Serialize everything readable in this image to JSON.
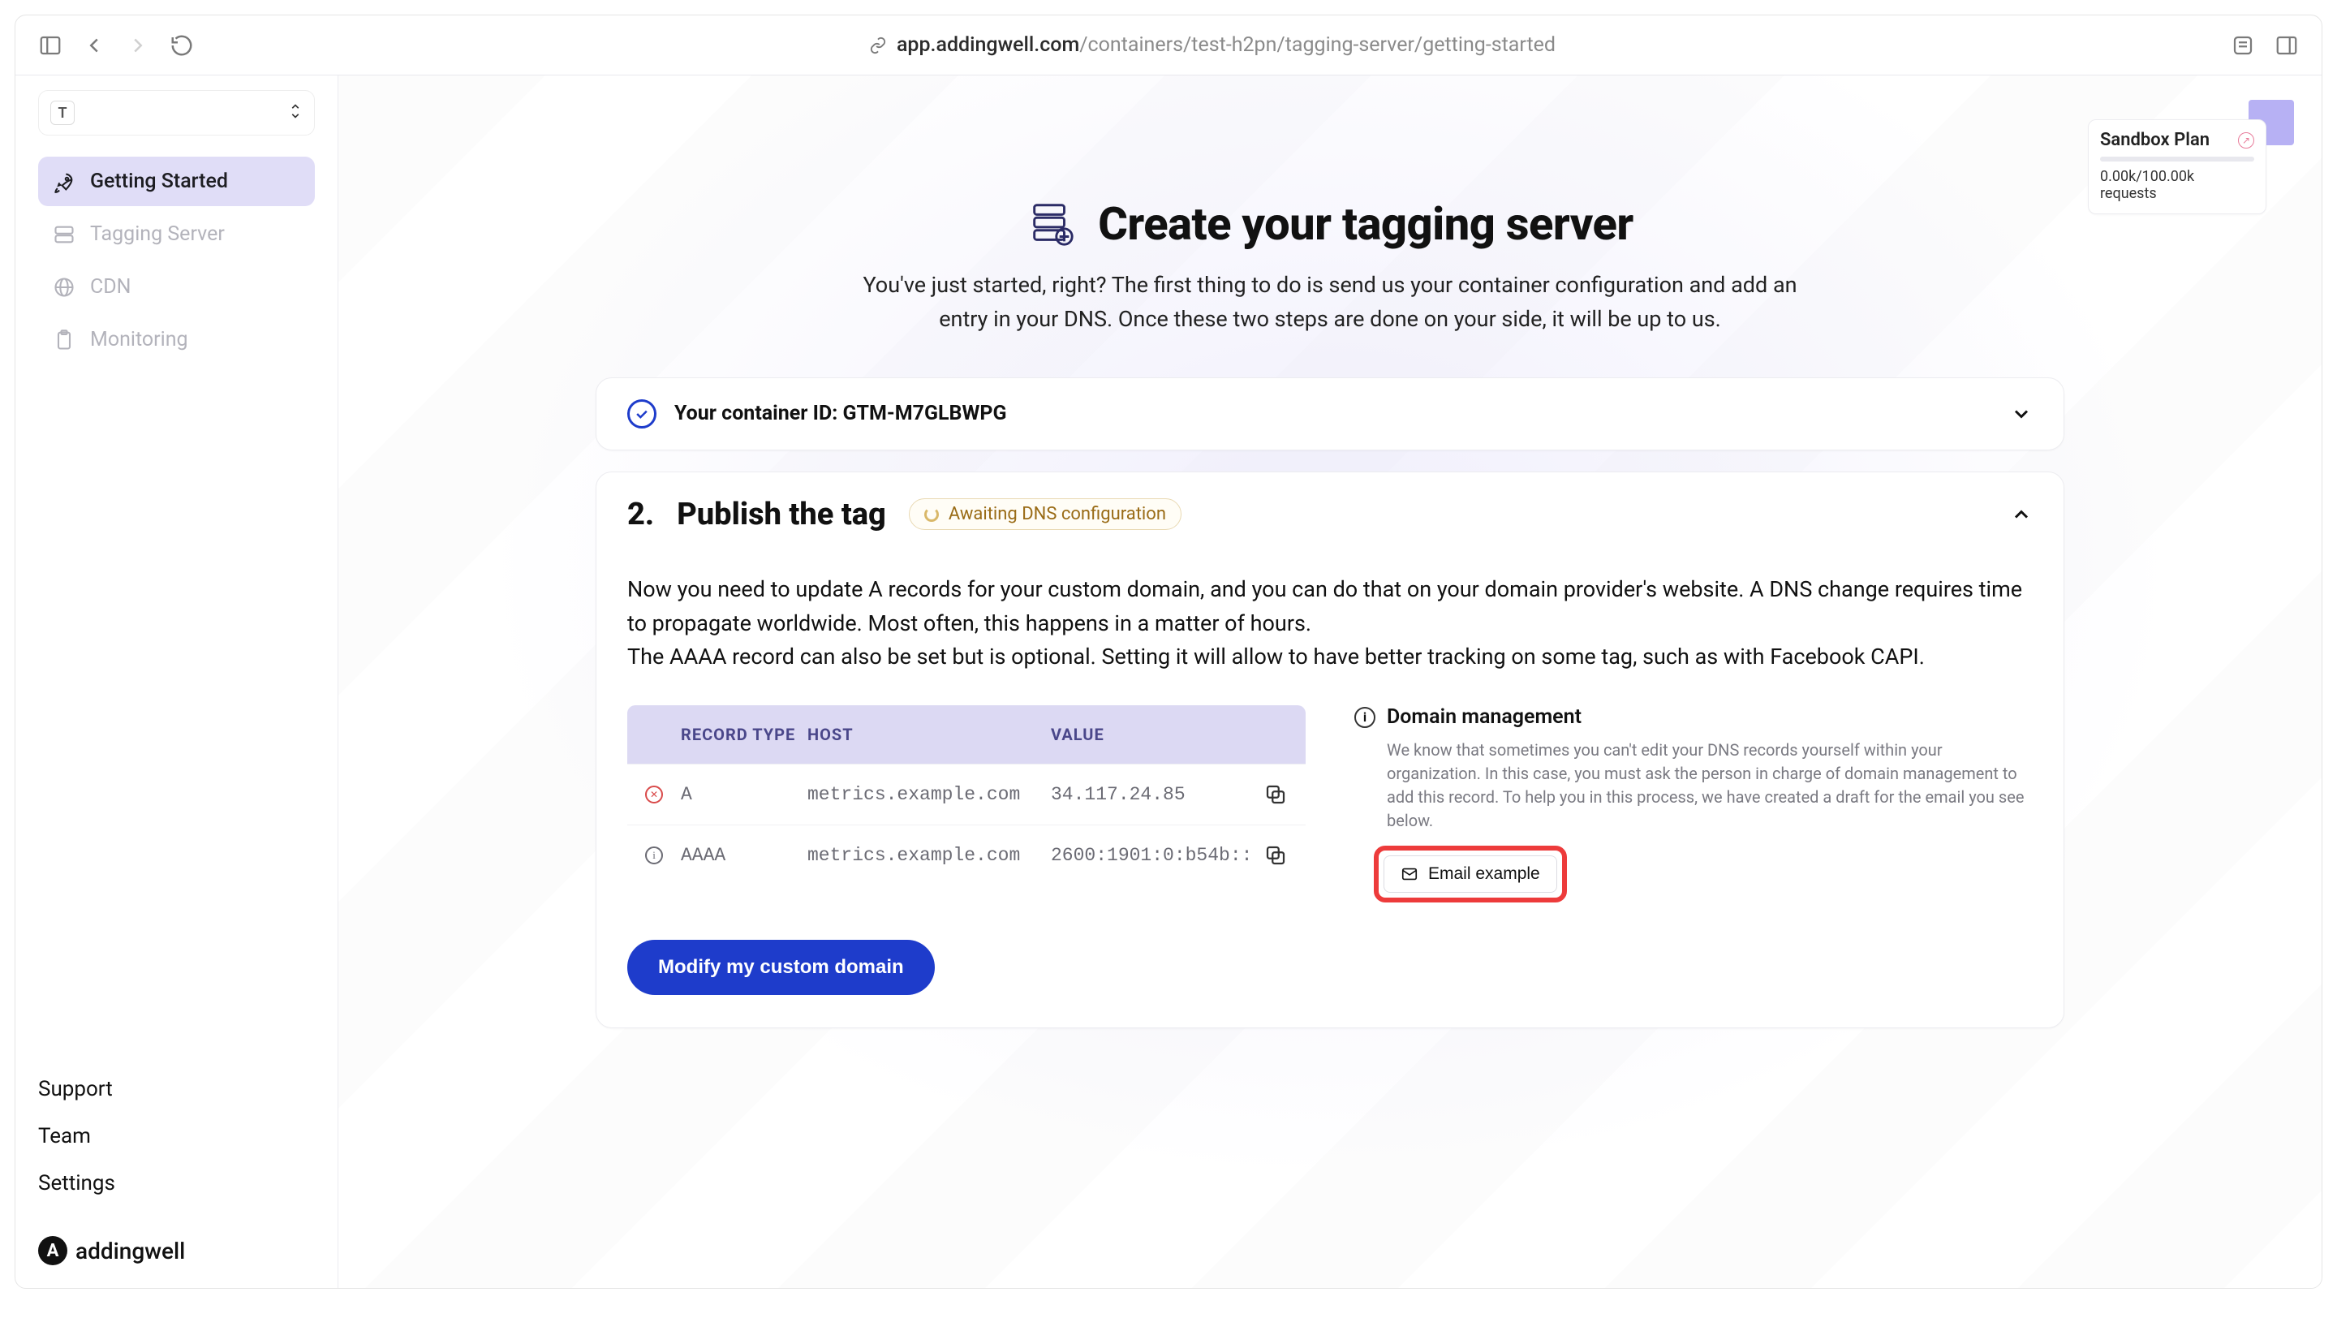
{
  "browser": {
    "url_host": "app.addingwell.com",
    "url_path": "/containers/test-h2pn/tagging-server/getting-started"
  },
  "workspace": {
    "initial": "T",
    "name": "  "
  },
  "sidebar": {
    "items": [
      {
        "label": "Getting Started"
      },
      {
        "label": "Tagging Server"
      },
      {
        "label": "CDN"
      },
      {
        "label": "Monitoring"
      }
    ],
    "footer": {
      "support": "Support",
      "team": "Team",
      "settings": "Settings"
    }
  },
  "brand": {
    "initial": "A",
    "name": "addingwell"
  },
  "plan": {
    "title": "Sandbox Plan",
    "requests": "0.00k/100.00k requests"
  },
  "hero": {
    "title": "Create your tagging server",
    "subtitle": "You've just started, right? The first thing to do is send us your container configuration and add an entry in your DNS. Once these two steps are done on your side, it will be up to us."
  },
  "step1": {
    "title": "Your container ID: GTM-M7GLBWPG"
  },
  "step2": {
    "number": "2.",
    "title": "Publish the tag",
    "badge": "Awaiting DNS configuration",
    "para1": "Now you need to update A records for your custom domain, and you can do that on your domain provider's website. A DNS change requires time to propagate worldwide. Most often, this happens in a matter of hours.",
    "para2": "The AAAA record can also be set but is optional. Setting it will allow to have better tracking on some tag, such as with Facebook CAPI.",
    "table": {
      "headers": {
        "type": "RECORD TYPE",
        "host": "HOST",
        "value": "VALUE"
      },
      "rows": [
        {
          "status": "error",
          "type": "A",
          "host": "metrics.example.com",
          "value": "34.117.24.85"
        },
        {
          "status": "info",
          "type": "AAAA",
          "host": "metrics.example.com",
          "value": "2600:1901:0:b54b::"
        }
      ]
    },
    "help": {
      "title": "Domain management",
      "text": "We know that sometimes you can't edit your DNS records yourself within your organization. In this case, you must ask the person in charge of domain management to add this record. To help you in this process, we have created a draft for the email you see below.",
      "email_button": "Email example"
    },
    "modify_button": "Modify my custom domain"
  }
}
